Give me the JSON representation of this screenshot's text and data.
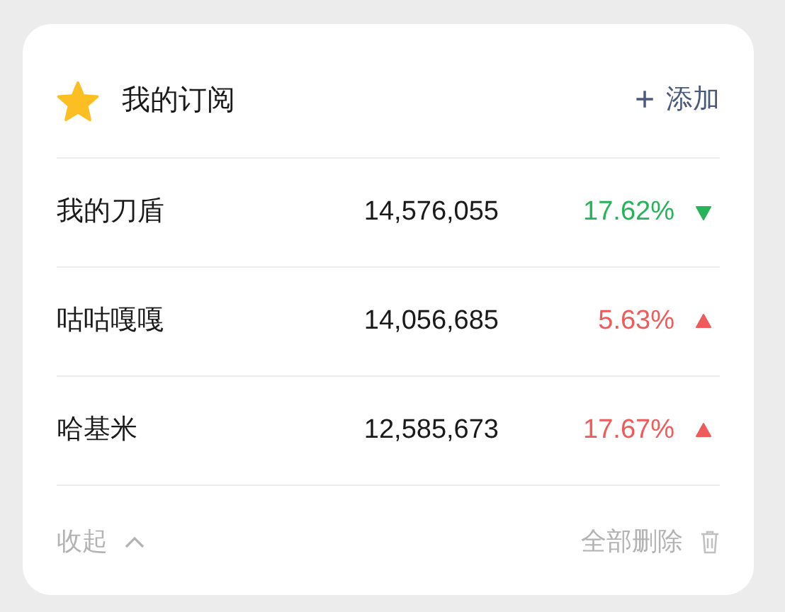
{
  "header": {
    "title": "我的订阅",
    "add_button": {
      "icon": "+",
      "label": "添加"
    }
  },
  "rows": [
    {
      "name": "我的刀盾",
      "value": "14,576,055",
      "change": "17.62%",
      "kind": "down"
    },
    {
      "name": "咕咕嘎嘎",
      "value": "14,056,685",
      "change": "5.63%",
      "kind": "up"
    },
    {
      "name": "哈基米",
      "value": "12,585,673",
      "change": "17.67%",
      "kind": "up"
    }
  ],
  "footer": {
    "collapse": "收起",
    "delete_all": "全部删除"
  }
}
